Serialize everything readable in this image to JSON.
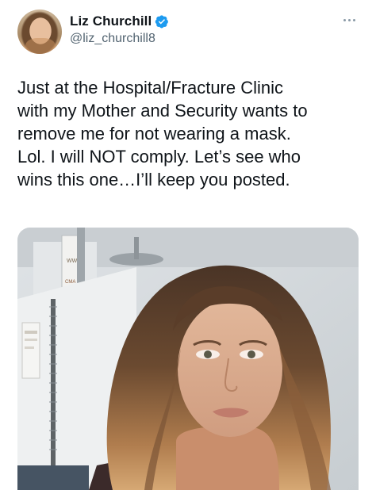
{
  "author": {
    "display_name": "Liz Churchill",
    "handle": "@liz_churchill8",
    "verified": true,
    "verified_color": "#1d9bf0"
  },
  "tweet": {
    "text": "Just at the Hospital/Fracture Clinic\nwith my Mother and Security wants to\nremove me for not wearing a mask.\nLol. I will NOT comply. Let’s see who\nwins this one…I’ll keep you posted."
  },
  "media": {
    "sign_text": "WW\nCMA"
  },
  "icons": {
    "verified": "verified-badge-icon",
    "more": "more-options-icon"
  }
}
